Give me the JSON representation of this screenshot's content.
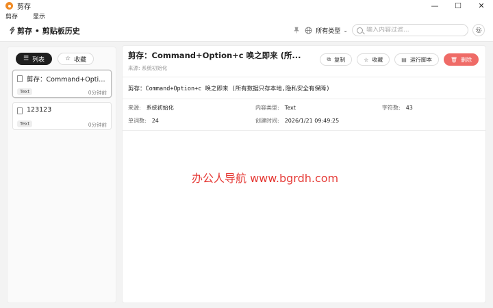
{
  "window": {
    "title": "剪存",
    "controls": {
      "minimize": "—",
      "maximize": "☐",
      "close": "✕"
    }
  },
  "menu": [
    "剪存",
    "显示"
  ],
  "header": {
    "title": "剪存 • 剪贴板历史",
    "type_filter": "所有类型",
    "search_placeholder": "输入内容过滤..."
  },
  "sidebar": {
    "tabs": [
      {
        "label": "列表",
        "icon": "list-icon",
        "active": true
      },
      {
        "label": "收藏",
        "icon": "star-icon",
        "active": false
      }
    ],
    "items": [
      {
        "text": "剪存：Command+Option+...",
        "type": "Text",
        "time": "0分钟前",
        "selected": true
      },
      {
        "text": "123123",
        "type": "Text",
        "time": "0分钟前",
        "selected": false
      }
    ]
  },
  "detail": {
    "title": "剪存：Command+Option+c 唤之即来 (所...",
    "source_line": "来源: 系统初始化",
    "actions": [
      {
        "label": "复制",
        "icon": "copy-icon"
      },
      {
        "label": "收藏",
        "icon": "star-icon"
      },
      {
        "label": "运行脚本",
        "icon": "script-icon"
      },
      {
        "label": "删除",
        "icon": "trash-icon"
      }
    ],
    "content": "剪存：Command+Option+c 唤之即来 (所有数据只存本地,隐私安全有保障)",
    "meta": {
      "source_label": "来源:",
      "source_value": "系统初始化",
      "type_label": "内容类型:",
      "type_value": "Text",
      "chars_label": "字符数:",
      "chars_value": "43",
      "words_label": "单词数:",
      "words_value": "24",
      "created_label": "创建时间:",
      "created_value": "2026/1/21 09:49:25"
    }
  },
  "watermark": "办公人导航 www.bgrdh.com",
  "colors": {
    "accent_dark": "#1f1f1f",
    "danger": "#ef6b67",
    "watermark": "#e53935"
  }
}
